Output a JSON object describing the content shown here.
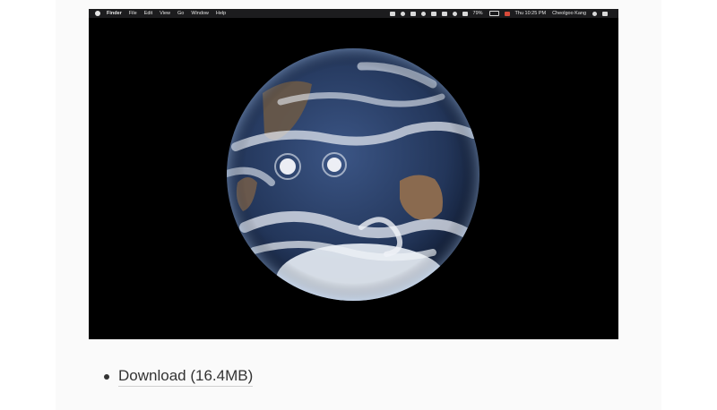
{
  "menubar": {
    "left_items": [
      "Finder",
      "File",
      "Edit",
      "View",
      "Go",
      "Window",
      "Help"
    ],
    "battery": "79%",
    "clock": "Thu 10:25 PM",
    "user": "Cheolgoo Kang",
    "icons": [
      "apple-icon",
      "display-icon",
      "cloud-icon",
      "clipboard-icon",
      "time-machine-icon",
      "bluetooth-icon",
      "airplay-icon",
      "wifi-icon",
      "volume-icon",
      "battery-icon",
      "record-icon",
      "spotlight-icon",
      "notification-center-icon"
    ]
  },
  "earth": {
    "ocean_color": "#2a3d63",
    "cloud_color": "#e9eef5",
    "land_color": "#8a6a4f"
  },
  "download": {
    "label": "Download (16.4MB)"
  }
}
